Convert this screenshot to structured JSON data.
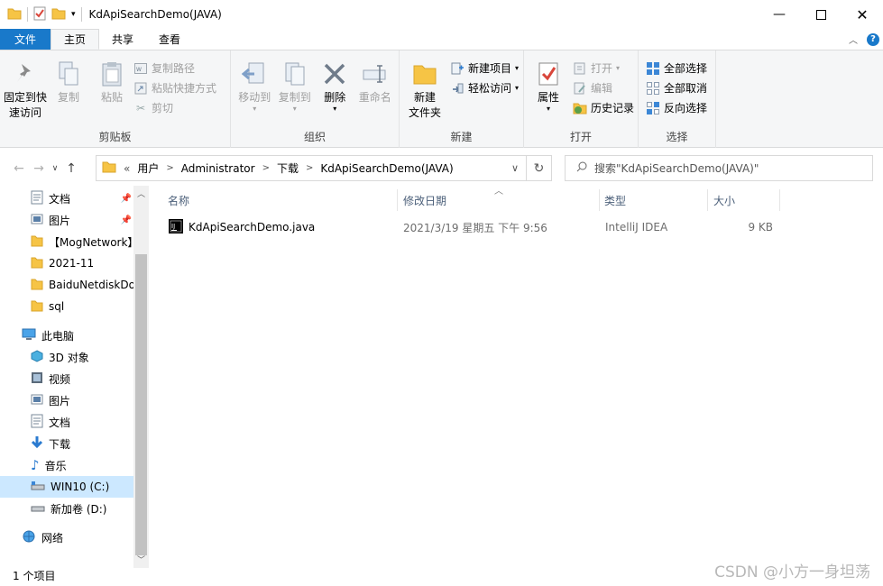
{
  "window": {
    "title": "KdApiSearchDemo(JAVA)"
  },
  "tabs": [
    {
      "label": "文件"
    },
    {
      "label": "主页"
    },
    {
      "label": "共享"
    },
    {
      "label": "查看"
    }
  ],
  "ribbon": {
    "clipboard": {
      "name": "剪贴板",
      "pin_label_1": "固定到快",
      "pin_label_2": "速访问",
      "copy": "复制",
      "paste": "粘贴",
      "copy_path": "复制路径",
      "paste_shortcut": "粘贴快捷方式",
      "cut": "剪切"
    },
    "organize": {
      "name": "组织",
      "move_to": "移动到",
      "copy_to": "复制到",
      "delete": "删除",
      "rename": "重命名"
    },
    "new": {
      "name": "新建",
      "new_folder_1": "新建",
      "new_folder_2": "文件夹",
      "new_item": "新建项目",
      "easy_access": "轻松访问"
    },
    "open": {
      "name": "打开",
      "properties": "属性",
      "open": "打开",
      "edit": "编辑",
      "history": "历史记录"
    },
    "select": {
      "name": "选择",
      "select_all": "全部选择",
      "select_none": "全部取消",
      "invert": "反向选择"
    }
  },
  "address": {
    "overflow": "«",
    "crumbs": [
      "用户",
      "Administrator",
      "下载",
      "KdApiSearchDemo(JAVA)"
    ]
  },
  "search": {
    "placeholder": "搜索\"KdApiSearchDemo(JAVA)\""
  },
  "navpane": {
    "quick": [
      {
        "label": "文档",
        "pinned": true
      },
      {
        "label": "图片",
        "pinned": true
      },
      {
        "label": "【MogNetwork】"
      },
      {
        "label": "2021-11"
      },
      {
        "label": "BaiduNetdiskDo"
      },
      {
        "label": "sql"
      }
    ],
    "this_pc": "此电脑",
    "pc_items": [
      {
        "label": "3D 对象"
      },
      {
        "label": "视频"
      },
      {
        "label": "图片"
      },
      {
        "label": "文档"
      },
      {
        "label": "下载"
      },
      {
        "label": "音乐"
      },
      {
        "label": "WIN10 (C:)"
      },
      {
        "label": "新加卷 (D:)"
      }
    ],
    "network": "网络"
  },
  "columns": {
    "name": "名称",
    "date": "修改日期",
    "type": "类型",
    "size": "大小"
  },
  "files": [
    {
      "name": "KdApiSearchDemo.java",
      "date": "2021/3/19 星期五 下午 9:56",
      "type": "IntelliJ IDEA",
      "size": "9 KB"
    }
  ],
  "status": {
    "count": "1 个项目"
  },
  "watermark": "CSDN @小方一身坦荡",
  "colors": {
    "accent": "#1979ca",
    "selection": "#cce8ff",
    "folder": "#f6c445"
  }
}
